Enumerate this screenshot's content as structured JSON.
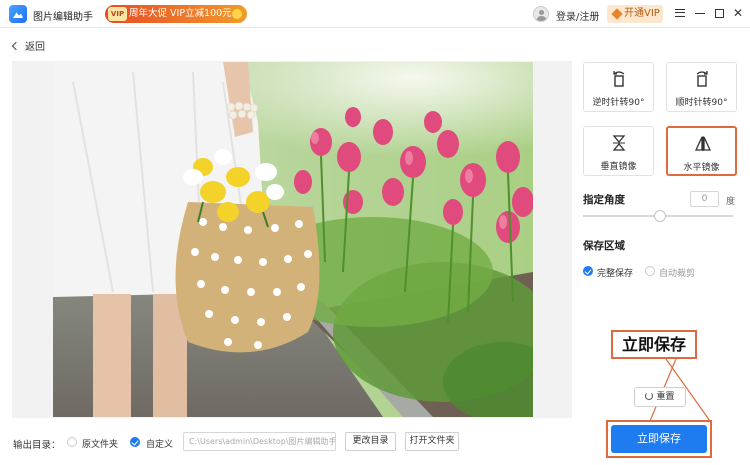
{
  "titlebar": {
    "app_title": "图片编辑助手",
    "promo_badge": "VIP",
    "promo_text": "周年大促 VIP立减100元",
    "login_label": "登录/注册",
    "vip_button": "开通VIP"
  },
  "nav": {
    "back_label": "返回"
  },
  "tools": {
    "rotate_ccw": "逆时针转90°",
    "rotate_cw": "顺时针转90°",
    "flip_vertical": "垂直镜像",
    "flip_horizontal": "水平镜像"
  },
  "angle": {
    "title": "指定角度",
    "value": "0",
    "unit": "度",
    "slider_fraction": 0.5
  },
  "save_area": {
    "title": "保存区域",
    "options": [
      {
        "label": "完整保存",
        "checked": true
      },
      {
        "label": "自动裁剪",
        "checked": false
      }
    ]
  },
  "annotation": {
    "label": "立即保存"
  },
  "reset_button": "重置",
  "save_button": "立即保存",
  "output": {
    "label": "输出目录：",
    "option_original": "原文件夹",
    "option_custom": "自定义",
    "path_placeholder": "C:\\Users\\admin\\Desktop\\图片编辑助手",
    "change_dir_button": "更改目录",
    "open_folder_button": "打开文件夹"
  },
  "colors": {
    "accent": "#1f7cf0",
    "highlight": "#e0693e",
    "promo": "#e84a23"
  }
}
